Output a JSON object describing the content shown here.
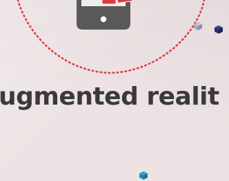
{
  "headline": "ugmented realit",
  "colors": {
    "background": "#ede3e4",
    "dotted_ring": "#e03a3e",
    "phone": "#595959",
    "phone_screen": "#ffffff",
    "cards": "#e03a3e",
    "text": "#3a3a3a",
    "cube_navy": "#2a2f6b",
    "cube_lavender": "#a8a6c8",
    "cube_teal": "#1a8fb0"
  },
  "icons": [
    "smartphone-icon",
    "card-stack-icon",
    "cube-icon"
  ]
}
